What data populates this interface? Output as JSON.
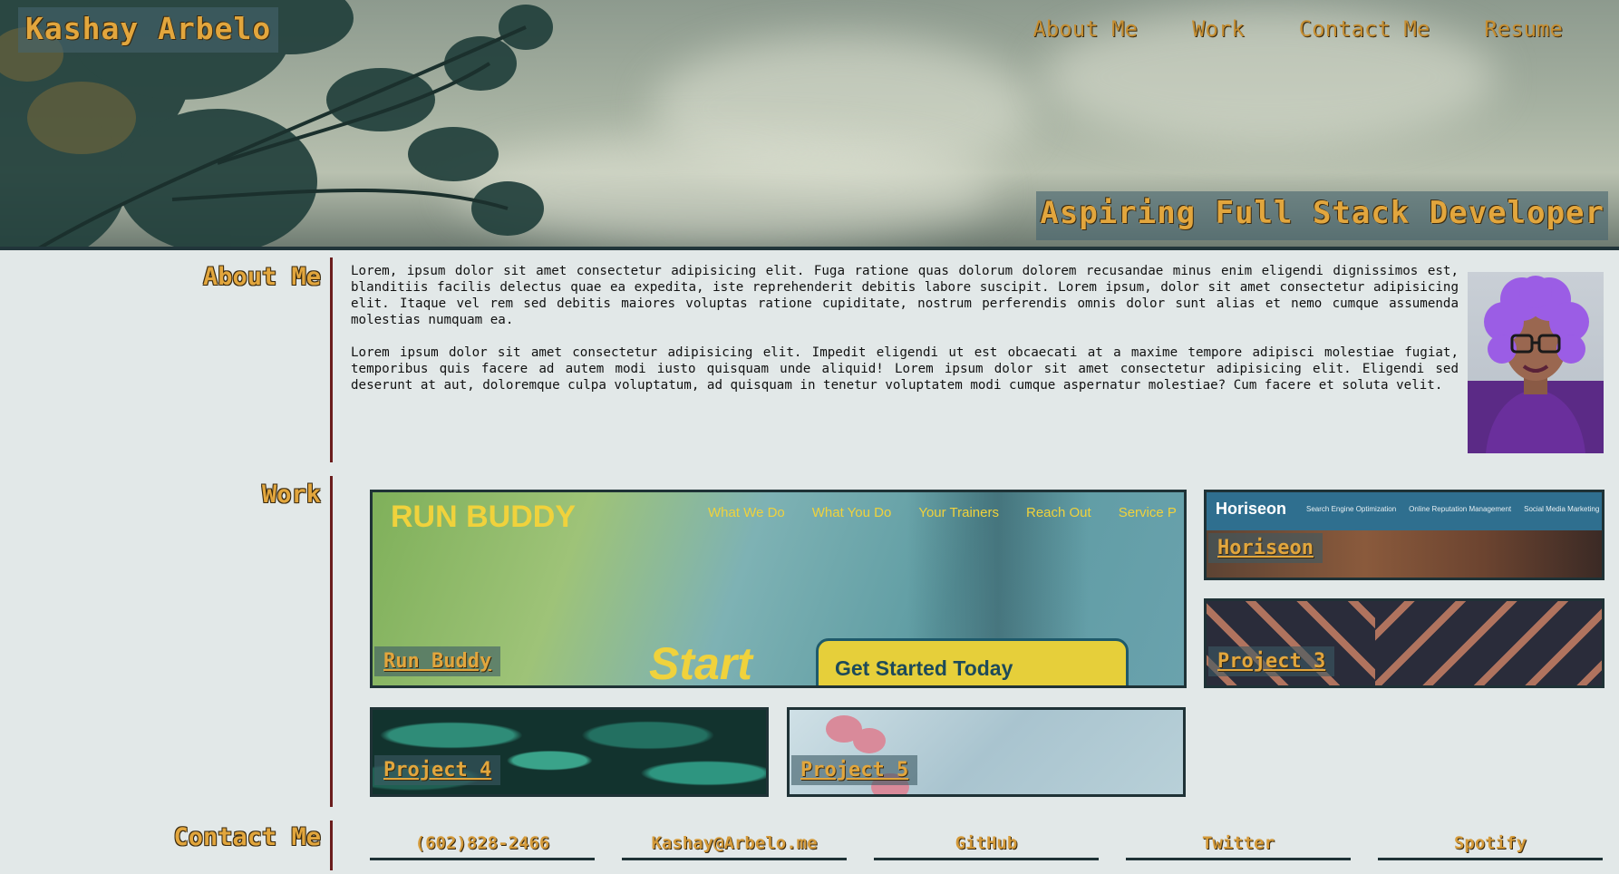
{
  "header": {
    "brand": "Kashay Arbelo",
    "nav": [
      "About Me",
      "Work",
      "Contact Me",
      "Resume"
    ],
    "tagline": "Aspiring Full Stack Developer"
  },
  "about": {
    "title": "About Me",
    "paragraphs": [
      "Lorem, ipsum dolor sit amet consectetur adipisicing elit. Fuga ratione quas dolorum dolorem recusandae minus enim eligendi dignissimos est, blanditiis facilis delectus quae ea expedita, iste reprehenderit debitis labore suscipit. Lorem ipsum, dolor sit amet consectetur adipisicing elit. Itaque vel rem sed debitis maiores voluptas ratione cupiditate, nostrum perferendis omnis dolor sunt alias et nemo cumque assumenda molestias numquam ea.",
      "Lorem ipsum dolor sit amet consectetur adipisicing elit. Impedit eligendi ut est obcaecati at a maxime tempore adipisci molestiae fugiat, temporibus quis facere ad autem modi iusto quisquam unde aliquid! Lorem ipsum dolor sit amet consectetur adipisicing elit. Eligendi sed deserunt at aut, doloremque culpa voluptatum, ad quisquam in tenetur voluptatem modi cumque aspernatur molestiae? Cum facere et soluta velit."
    ]
  },
  "work": {
    "title": "Work",
    "projects": [
      {
        "label": "Run Buddy"
      },
      {
        "label": "Horiseon"
      },
      {
        "label": "Project 3"
      },
      {
        "label": "Project 4"
      },
      {
        "label": "Project 5"
      }
    ],
    "run_buddy_preview": {
      "title": "RUN BUDDY",
      "nav": [
        "What We Do",
        "What You Do",
        "Your Trainers",
        "Reach Out",
        "Service P"
      ],
      "start": "Start",
      "cta": "Get Started Today"
    },
    "horiseon_preview": {
      "brand": "Horiseon",
      "nav": [
        "Search Engine Optimization",
        "Online Reputation Management",
        "Social Media Marketing"
      ]
    }
  },
  "contact": {
    "title": "Contact Me",
    "links": [
      "(602)828-2466",
      "Kashay@Arbelo.me",
      "GitHub",
      "Twitter",
      "Spotify"
    ]
  },
  "colors": {
    "accent": "#e2a63d",
    "divider": "#6b1d1d",
    "background": "#e2e8e8"
  }
}
